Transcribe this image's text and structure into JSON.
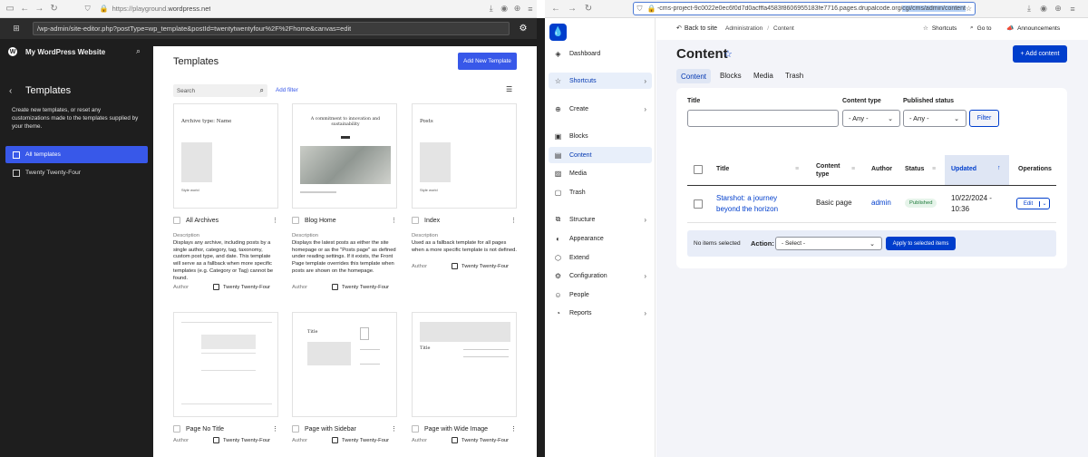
{
  "wp_browser": {
    "url_prefix": "https://playground.",
    "url_domain": "wordpress.net",
    "editor_path": "/wp-admin/site-editor.php?postType=wp_template&postId=twentytwentyfour%2F%2Fhome&canvas=edit"
  },
  "wp_sidebar": {
    "site_title": "My WordPress Website",
    "section_title": "Templates",
    "description": "Create new templates, or reset any customizations made to the templates supplied by your theme.",
    "items": [
      {
        "label": "All templates"
      },
      {
        "label": "Twenty Twenty-Four"
      }
    ]
  },
  "wp_main": {
    "title": "Templates",
    "add_button": "Add New Template",
    "search_placeholder": "Search",
    "add_filter": "Add filter",
    "description_label": "Description",
    "author_label": "Author",
    "cards": [
      {
        "name": "All Archives",
        "description": "Displays any archive, including posts by a single author, category, tag, taxonomy, custom post type, and date. This template will serve as a fallback when more specific templates (e.g. Category or Tag) cannot be found.",
        "author": "Twenty Twenty-Four",
        "thumb_title": "Archive type: Name",
        "thumb_footer": "Style world"
      },
      {
        "name": "Blog Home",
        "description": "Displays the latest posts as either the site homepage or as the \"Posts page\" as defined under reading settings. If it exists, the Front Page template overrides this template when posts are shown on the homepage.",
        "author": "Twenty Twenty-Four",
        "thumb_title": "A commitment to innovation and sustainability",
        "thumb_footer": ""
      },
      {
        "name": "Index",
        "description": "Used as a fallback template for all pages when a more specific template is not defined.",
        "author": "Twenty Twenty-Four",
        "thumb_title": "Posts",
        "thumb_footer": "Style world"
      },
      {
        "name": "Page No Title",
        "description": "",
        "author": "Twenty Twenty-Four",
        "thumb_title": "",
        "thumb_footer": ""
      },
      {
        "name": "Page with Sidebar",
        "description": "",
        "author": "Twenty Twenty-Four",
        "thumb_title": "Title",
        "thumb_footer": ""
      },
      {
        "name": "Page with Wide Image",
        "description": "",
        "author": "Twenty Twenty-Four",
        "thumb_title": "Title",
        "thumb_footer": ""
      }
    ]
  },
  "drupal_browser": {
    "url_main": "-cms-project-9c0022e0ec6f0d7d0acfffa4583f8606955183fe7716.pages.drupalcode.org/",
    "url_selected": "cgi/cms/admin/content"
  },
  "drupal_sidebar": {
    "items": [
      {
        "label": "Dashboard",
        "icon": "drop-icon"
      },
      {
        "label": "Shortcuts",
        "icon": "star-icon"
      },
      {
        "label": "Create",
        "icon": "plus-icon"
      },
      {
        "label": "Blocks",
        "icon": "blocks-icon"
      },
      {
        "label": "Content",
        "icon": "content-icon"
      },
      {
        "label": "Media",
        "icon": "media-icon"
      },
      {
        "label": "Trash",
        "icon": "trash-icon"
      },
      {
        "label": "Structure",
        "icon": "structure-icon"
      },
      {
        "label": "Appearance",
        "icon": "appearance-icon"
      },
      {
        "label": "Extend",
        "icon": "extend-icon"
      },
      {
        "label": "Configuration",
        "icon": "config-icon"
      },
      {
        "label": "People",
        "icon": "people-icon"
      },
      {
        "label": "Reports",
        "icon": "reports-icon"
      }
    ]
  },
  "drupal_main": {
    "back_link": "Back to site",
    "breadcrumb": [
      "Administration",
      "Content"
    ],
    "top_actions": [
      "Shortcuts",
      "Go to",
      "Announcements"
    ],
    "page_title": "Content",
    "add_button": "+ Add content",
    "tabs": [
      "Content",
      "Blocks",
      "Media",
      "Trash"
    ],
    "filters": {
      "title_label": "Title",
      "content_type_label": "Content type",
      "content_type_value": "- Any -",
      "status_label": "Published status",
      "status_value": "- Any -",
      "filter_button": "Filter"
    },
    "table": {
      "headers": [
        "Title",
        "Content type",
        "Author",
        "Status",
        "Updated",
        "Operations"
      ],
      "row": {
        "title": "Starshot: a journey beyond the horizon",
        "content_type": "Basic page",
        "author": "admin",
        "status": "Published",
        "updated": "10/22/2024 - 10:36",
        "operation": "Edit"
      }
    },
    "bulk": {
      "none_selected": "No items selected",
      "action_label": "Action:",
      "action_value": "- Select -",
      "apply_button": "Apply to selected items"
    }
  },
  "colors": {
    "wp_accent": "#3858e9",
    "drupal_accent": "#003ecc",
    "published_bg": "#e6f4ea",
    "published_text": "#1d7a3a"
  }
}
